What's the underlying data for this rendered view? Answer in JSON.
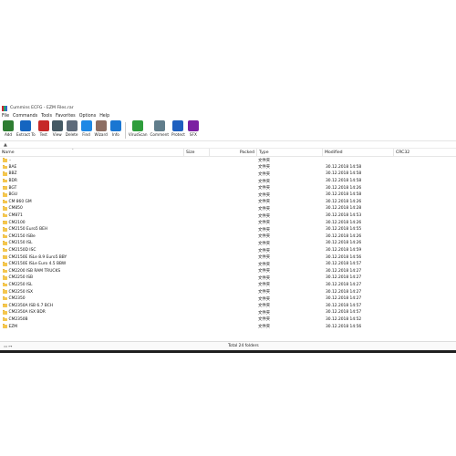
{
  "window": {
    "title": "Cummins ECFG - EZM Files.rar"
  },
  "menu": [
    "File",
    "Commands",
    "Tools",
    "Favorites",
    "Options",
    "Help"
  ],
  "toolbar": [
    {
      "label": "Add",
      "icon": "add-archive-icon",
      "color": "#2e7d32"
    },
    {
      "label": "Extract To",
      "icon": "extract-icon",
      "color": "#1565c0"
    },
    {
      "label": "Test",
      "icon": "test-icon",
      "color": "#c62828"
    },
    {
      "label": "View",
      "icon": "view-icon",
      "color": "#455a64"
    },
    {
      "label": "Delete",
      "icon": "delete-icon",
      "color": "#5e6b7a"
    },
    {
      "label": "Find",
      "icon": "find-icon",
      "color": "#1e88e5"
    },
    {
      "label": "Wizard",
      "icon": "wizard-icon",
      "color": "#8d6e63"
    },
    {
      "label": "Info",
      "icon": "info-icon",
      "color": "#1976d2"
    },
    {
      "label": "VirusScan",
      "icon": "virusscan-icon",
      "color": "#2e9d3c"
    },
    {
      "label": "Comment",
      "icon": "comment-icon",
      "color": "#607d8b"
    },
    {
      "label": "Protect",
      "icon": "protect-icon",
      "color": "#1e5fbf"
    },
    {
      "label": "SFX",
      "icon": "sfx-icon",
      "color": "#7b1fa2"
    }
  ],
  "columns": {
    "name": "Name",
    "size": "Size",
    "packed": "Packed",
    "type": "Type",
    "modified": "Modified",
    "crc": "CRC32"
  },
  "rows": [
    {
      "name": "..",
      "type": "文件夹",
      "modified": ""
    },
    {
      "name": "BAE",
      "type": "文件夹",
      "modified": "30.12.2018 14:58"
    },
    {
      "name": "BBZ",
      "type": "文件夹",
      "modified": "30.12.2018 14:58"
    },
    {
      "name": "BDR",
      "type": "文件夹",
      "modified": "30.12.2018 14:58"
    },
    {
      "name": "BGT",
      "type": "文件夹",
      "modified": "30.12.2018 14:26"
    },
    {
      "name": "BGU",
      "type": "文件夹",
      "modified": "30.12.2018 14:58"
    },
    {
      "name": "CM 860 GM",
      "type": "文件夹",
      "modified": "30.12.2018 14:26"
    },
    {
      "name": "CM850",
      "type": "文件夹",
      "modified": "30.12.2018 14:28"
    },
    {
      "name": "CM871",
      "type": "文件夹",
      "modified": "30.12.2018 14:53"
    },
    {
      "name": "CM2100",
      "type": "文件夹",
      "modified": "30.12.2018 14:26"
    },
    {
      "name": "CM2150 Euro5 BEH",
      "type": "文件夹",
      "modified": "30.12.2018 14:55"
    },
    {
      "name": "CM2150 ISBe",
      "type": "文件夹",
      "modified": "30.12.2018 14:26"
    },
    {
      "name": "CM2150 ISL",
      "type": "文件夹",
      "modified": "30.12.2018 14:26"
    },
    {
      "name": "CM2150D ISC",
      "type": "文件夹",
      "modified": "30.12.2018 14:59"
    },
    {
      "name": "CM2150E ISLe 8.9 Euro5 BBY",
      "type": "文件夹",
      "modified": "30.12.2018 14:56"
    },
    {
      "name": "CM2150E ISLe Euro 4.5 BBW",
      "type": "文件夹",
      "modified": "30.12.2018 14:57"
    },
    {
      "name": "CM2200 ISB RAM TRUCKS",
      "type": "文件夹",
      "modified": "30.12.2018 14:27"
    },
    {
      "name": "CM2250 ISB",
      "type": "文件夹",
      "modified": "30.12.2018 14:27"
    },
    {
      "name": "CM2250 ISL",
      "type": "文件夹",
      "modified": "30.12.2018 14:27"
    },
    {
      "name": "CM2250 ISX",
      "type": "文件夹",
      "modified": "30.12.2018 14:27"
    },
    {
      "name": "CM2350",
      "type": "文件夹",
      "modified": "30.12.2018 14:27"
    },
    {
      "name": "CM2350A ISB 6.7 BCH",
      "type": "文件夹",
      "modified": "30.12.2018 14:57"
    },
    {
      "name": "CM2350A ISX BDR",
      "type": "文件夹",
      "modified": "30.12.2018 14:57"
    },
    {
      "name": "CM2350B",
      "type": "文件夹",
      "modified": "30.12.2018 14:52"
    },
    {
      "name": "EZM",
      "type": "文件夹",
      "modified": "30.12.2018 14:56"
    }
  ],
  "status": {
    "drive": "▭ ⊶",
    "text": "Total 24 folders"
  }
}
